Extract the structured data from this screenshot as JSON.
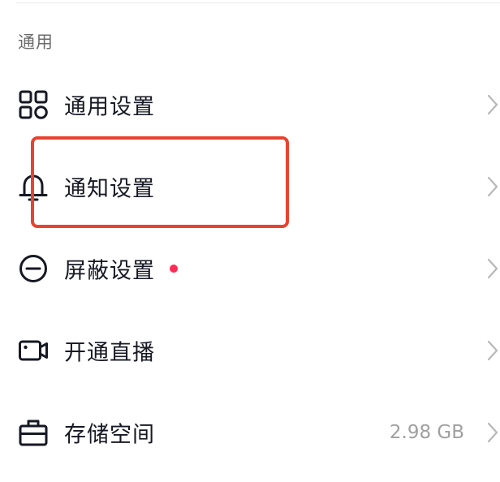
{
  "section": {
    "title": "通用"
  },
  "items": [
    {
      "label": "通用设置",
      "icon": "grid-icon",
      "value": "",
      "badge": false
    },
    {
      "label": "通知设置",
      "icon": "bell-icon",
      "value": "",
      "badge": false
    },
    {
      "label": "屏蔽设置",
      "icon": "block-icon",
      "value": "",
      "badge": true
    },
    {
      "label": "开通直播",
      "icon": "video-camera-icon",
      "value": "",
      "badge": false
    },
    {
      "label": "存储空间",
      "icon": "storage-box-icon",
      "value": "2.98 GB",
      "badge": false
    }
  ],
  "colors": {
    "text": "#161823",
    "secondary": "#a0a0a0",
    "badge": "#fe2c55",
    "highlight": "#e8432f"
  }
}
